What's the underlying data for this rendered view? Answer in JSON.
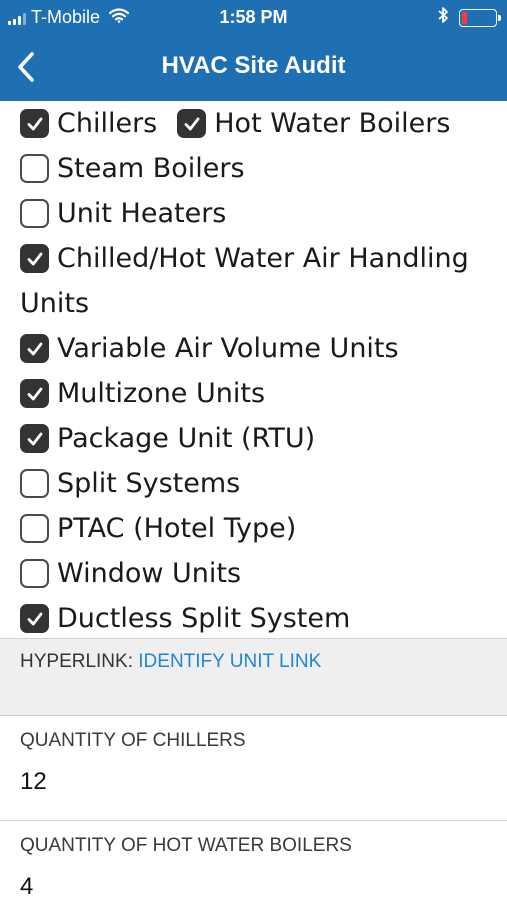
{
  "status_bar": {
    "carrier": "T-Mobile",
    "time": "1:58 PM"
  },
  "header": {
    "title": "HVAC Site Audit"
  },
  "equipment_checklist": {
    "rows": [
      [
        {
          "label": "Chillers",
          "checked": true
        },
        {
          "label": "Hot Water Boilers",
          "checked": true
        }
      ],
      [
        {
          "label": "Steam Boilers",
          "checked": false
        }
      ],
      [
        {
          "label": "Unit Heaters",
          "checked": false
        }
      ],
      [
        {
          "label": "Chilled/Hot Water Air Handling",
          "checked": true,
          "wrap": "Units"
        }
      ],
      [
        {
          "label": "Variable Air Volume Units",
          "checked": true
        }
      ],
      [
        {
          "label": "Multizone Units",
          "checked": true
        }
      ],
      [
        {
          "label": "Package Unit (RTU)",
          "checked": true
        }
      ],
      [
        {
          "label": "Split Systems",
          "checked": false
        }
      ],
      [
        {
          "label": "PTAC (Hotel Type)",
          "checked": false
        }
      ],
      [
        {
          "label": "Window Units",
          "checked": false
        }
      ],
      [
        {
          "label": "Ductless Split System",
          "checked": true
        }
      ]
    ]
  },
  "hyperlink": {
    "prefix": "HYPERLINK: ",
    "link_text": "IDENTIFY UNIT LINK"
  },
  "fields": {
    "chillers_qty": {
      "label": "QUANTITY OF CHILLERS",
      "value": "12"
    },
    "hot_water_boilers_qty": {
      "label": "QUANTITY OF HOT WATER BOILERS",
      "value": "4"
    }
  },
  "colors": {
    "header_blue": "#1f6fb3",
    "link_blue": "#1f86d6",
    "battery_red": "#ff3b30",
    "checkbox_dark": "#333333"
  },
  "icons": {
    "back": "chevron-left-icon",
    "wifi": "wifi-icon",
    "bluetooth": "bluetooth-icon",
    "battery": "battery-icon",
    "signal": "signal-bars-icon",
    "check": "checkmark-icon"
  },
  "battery_level": 0.15
}
